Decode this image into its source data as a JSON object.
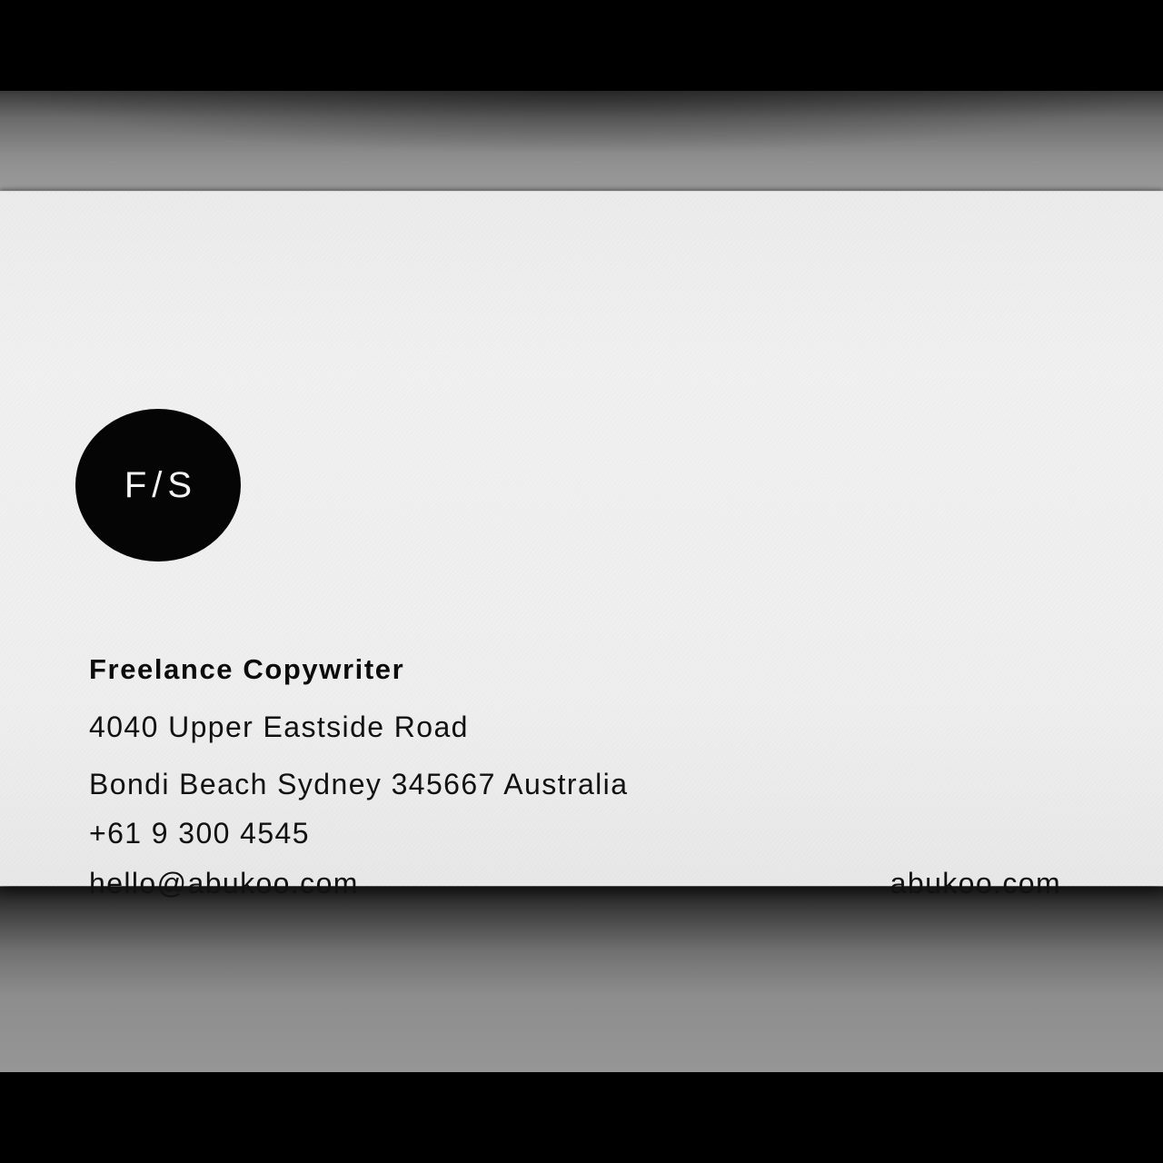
{
  "card": {
    "logo_text": "F/S",
    "title": "Freelance Copywriter",
    "address_line1": "4040 Upper Eastside Road",
    "address_line2": "Bondi Beach Sydney 345667 Australia",
    "phone": "+61 9 300 4545",
    "email": "hello@abukoo.com",
    "website": "abukoo.com"
  },
  "colors": {
    "card": "#efefef",
    "logo_fill": "#050505",
    "text": "#111111",
    "backdrop": "#8a8a8a",
    "frame": "#000000"
  }
}
